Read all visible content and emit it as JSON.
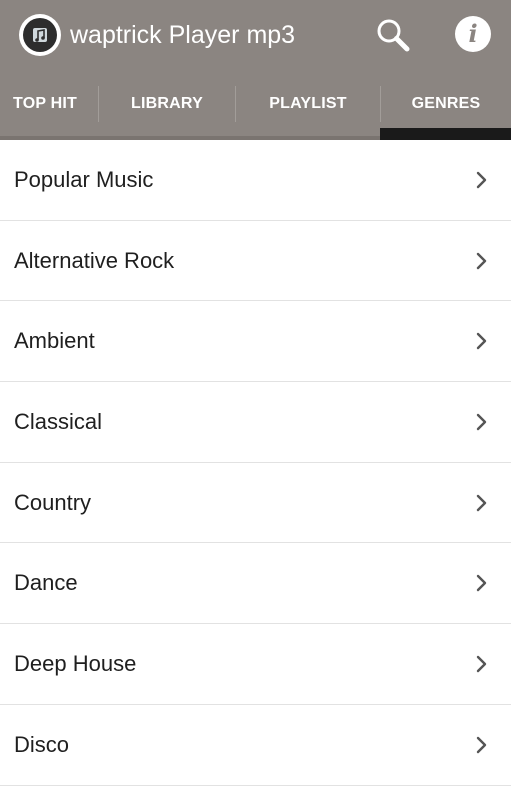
{
  "app": {
    "title": "waptrick Player mp3",
    "logo_icon": "music-note-icon",
    "colors": {
      "header_bg": "#8b8581",
      "active_tab_indicator": "#1a1a1a",
      "list_text": "#1f1f1f",
      "divider": "#e2e2e2"
    }
  },
  "header": {
    "search_icon": "search-icon",
    "info_icon": "info-icon",
    "info_glyph": "i"
  },
  "tabs": [
    {
      "label": "TOP HIT",
      "active": false
    },
    {
      "label": "LIBRARY",
      "active": false
    },
    {
      "label": "PLAYLIST",
      "active": false
    },
    {
      "label": "GENRES",
      "active": true
    }
  ],
  "genres": [
    {
      "label": "Popular Music"
    },
    {
      "label": "Alternative Rock"
    },
    {
      "label": "Ambient"
    },
    {
      "label": "Classical"
    },
    {
      "label": "Country"
    },
    {
      "label": "Dance"
    },
    {
      "label": "Deep House"
    },
    {
      "label": "Disco"
    }
  ]
}
